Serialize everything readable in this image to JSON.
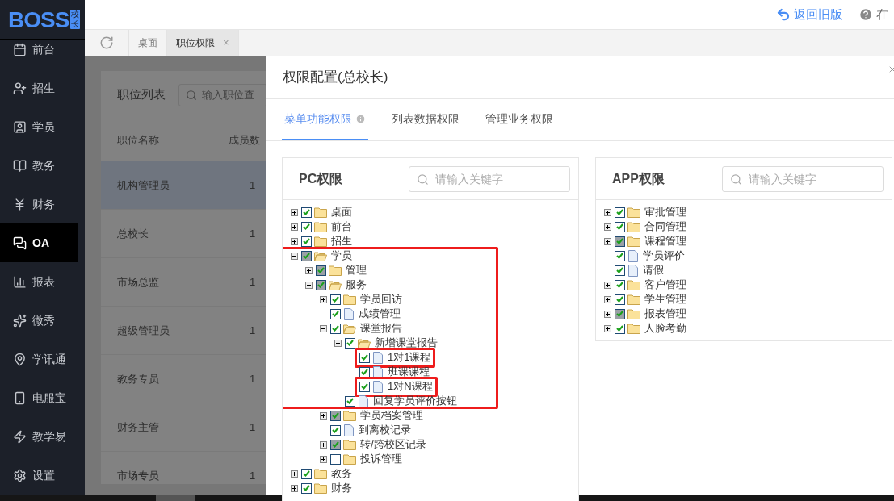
{
  "logo": {
    "text": "BOSS",
    "badge": "校长"
  },
  "sidebar": {
    "items": [
      {
        "label": "前台",
        "selected": false
      },
      {
        "label": "招生",
        "selected": false
      },
      {
        "label": "学员",
        "selected": false
      },
      {
        "label": "教务",
        "selected": false
      },
      {
        "label": "财务",
        "selected": false
      },
      {
        "label": "OA",
        "selected": true
      },
      {
        "label": "报表",
        "selected": false
      },
      {
        "label": "微秀",
        "selected": false
      },
      {
        "label": "学讯通",
        "selected": false
      },
      {
        "label": "电服宝",
        "selected": false
      },
      {
        "label": "教学易",
        "selected": false
      },
      {
        "label": "设置",
        "selected": false
      }
    ]
  },
  "topbar": {
    "back_link": "返回旧版",
    "help": "在"
  },
  "tabs": [
    {
      "label": "桌面",
      "selected": false
    },
    {
      "label": "职位权限",
      "selected": true,
      "close": "×"
    }
  ],
  "position_list": {
    "title": "职位列表",
    "search_placeholder": "输入职位查",
    "columns": [
      "职位名称",
      "成员数"
    ],
    "rows": [
      {
        "name": "机构管理员",
        "count": "1",
        "selected": true
      },
      {
        "name": "总校长",
        "count": "1",
        "selected": false
      },
      {
        "name": "市场总监",
        "count": "1",
        "selected": false
      },
      {
        "name": "超级管理员",
        "count": "1",
        "selected": false
      },
      {
        "name": "教务专员",
        "count": "1",
        "selected": false
      },
      {
        "name": "财务主管",
        "count": "1",
        "selected": false
      },
      {
        "name": "市场专员",
        "count": "1",
        "selected": false
      }
    ]
  },
  "dialog": {
    "title": "权限配置(总校长)",
    "tabs": [
      {
        "label": "菜单功能权限",
        "selected": true,
        "info": true
      },
      {
        "label": "列表数据权限",
        "selected": false,
        "info": false
      },
      {
        "label": "管理业务权限",
        "selected": false,
        "info": false
      }
    ],
    "panels": [
      {
        "title": "PC权限",
        "search_placeholder": "请输入关键字",
        "tree": [
          {
            "label": "桌面",
            "kind": "folder",
            "expanded": false,
            "checked": true,
            "partial": false
          },
          {
            "label": "前台",
            "kind": "folder",
            "expanded": false,
            "checked": true,
            "partial": false
          },
          {
            "label": "招生",
            "kind": "folder",
            "expanded": false,
            "checked": true,
            "partial": false
          },
          {
            "label": "学员",
            "kind": "folder",
            "expanded": true,
            "checked": true,
            "partial": true,
            "group_outline_start": true,
            "children": [
              {
                "label": "管理",
                "kind": "folder",
                "expanded": false,
                "checked": true,
                "partial": true
              },
              {
                "label": "服务",
                "kind": "folder",
                "expanded": true,
                "checked": true,
                "partial": true,
                "children": [
                  {
                    "label": "学员回访",
                    "kind": "folder",
                    "expanded": false,
                    "checked": true,
                    "partial": false
                  },
                  {
                    "label": "成绩管理",
                    "kind": "file",
                    "checked": true,
                    "partial": false
                  },
                  {
                    "label": "课堂报告",
                    "kind": "folder",
                    "expanded": true,
                    "checked": true,
                    "partial": false,
                    "children": [
                      {
                        "label": "新增课堂报告",
                        "kind": "folder",
                        "expanded": true,
                        "checked": true,
                        "partial": false,
                        "children": [
                          {
                            "label": "1对1课程",
                            "kind": "file",
                            "checked": true,
                            "partial": false,
                            "outlined": true
                          },
                          {
                            "label": "班课课程",
                            "kind": "file",
                            "checked": true,
                            "partial": false
                          },
                          {
                            "label": "1对N课程",
                            "kind": "file",
                            "checked": true,
                            "partial": false,
                            "outlined": true
                          }
                        ]
                      },
                      {
                        "label": "回复学员评价按钮",
                        "kind": "file",
                        "checked": true,
                        "partial": false,
                        "group_outline_end": true
                      }
                    ]
                  },
                  {
                    "label": "学员档案管理",
                    "kind": "folder",
                    "expanded": false,
                    "checked": true,
                    "partial": true
                  },
                  {
                    "label": "到离校记录",
                    "kind": "file",
                    "checked": true,
                    "partial": false
                  },
                  {
                    "label": "转/跨校区记录",
                    "kind": "folder",
                    "expanded": false,
                    "checked": true,
                    "partial": true
                  },
                  {
                    "label": "投诉管理",
                    "kind": "folder",
                    "expanded": false,
                    "checked": false,
                    "partial": false
                  }
                ]
              }
            ]
          },
          {
            "label": "教务",
            "kind": "folder",
            "expanded": false,
            "checked": true,
            "partial": false
          },
          {
            "label": "财务",
            "kind": "folder",
            "expanded": false,
            "checked": true,
            "partial": false
          }
        ]
      },
      {
        "title": "APP权限",
        "search_placeholder": "请输入关键字",
        "tree": [
          {
            "label": "审批管理",
            "kind": "folder",
            "expanded": false,
            "checked": true,
            "partial": false
          },
          {
            "label": "合同管理",
            "kind": "folder",
            "expanded": false,
            "checked": true,
            "partial": false
          },
          {
            "label": "课程管理",
            "kind": "folder",
            "expanded": false,
            "checked": true,
            "partial": true
          },
          {
            "label": "学员评价",
            "kind": "file",
            "checked": true,
            "partial": false
          },
          {
            "label": "请假",
            "kind": "file",
            "checked": true,
            "partial": false
          },
          {
            "label": "客户管理",
            "kind": "folder",
            "expanded": false,
            "checked": true,
            "partial": false
          },
          {
            "label": "学生管理",
            "kind": "folder",
            "expanded": false,
            "checked": true,
            "partial": false
          },
          {
            "label": "报表管理",
            "kind": "folder",
            "expanded": false,
            "checked": true,
            "partial": true
          },
          {
            "label": "人脸考勤",
            "kind": "folder",
            "expanded": false,
            "checked": true,
            "partial": false
          }
        ]
      }
    ]
  }
}
